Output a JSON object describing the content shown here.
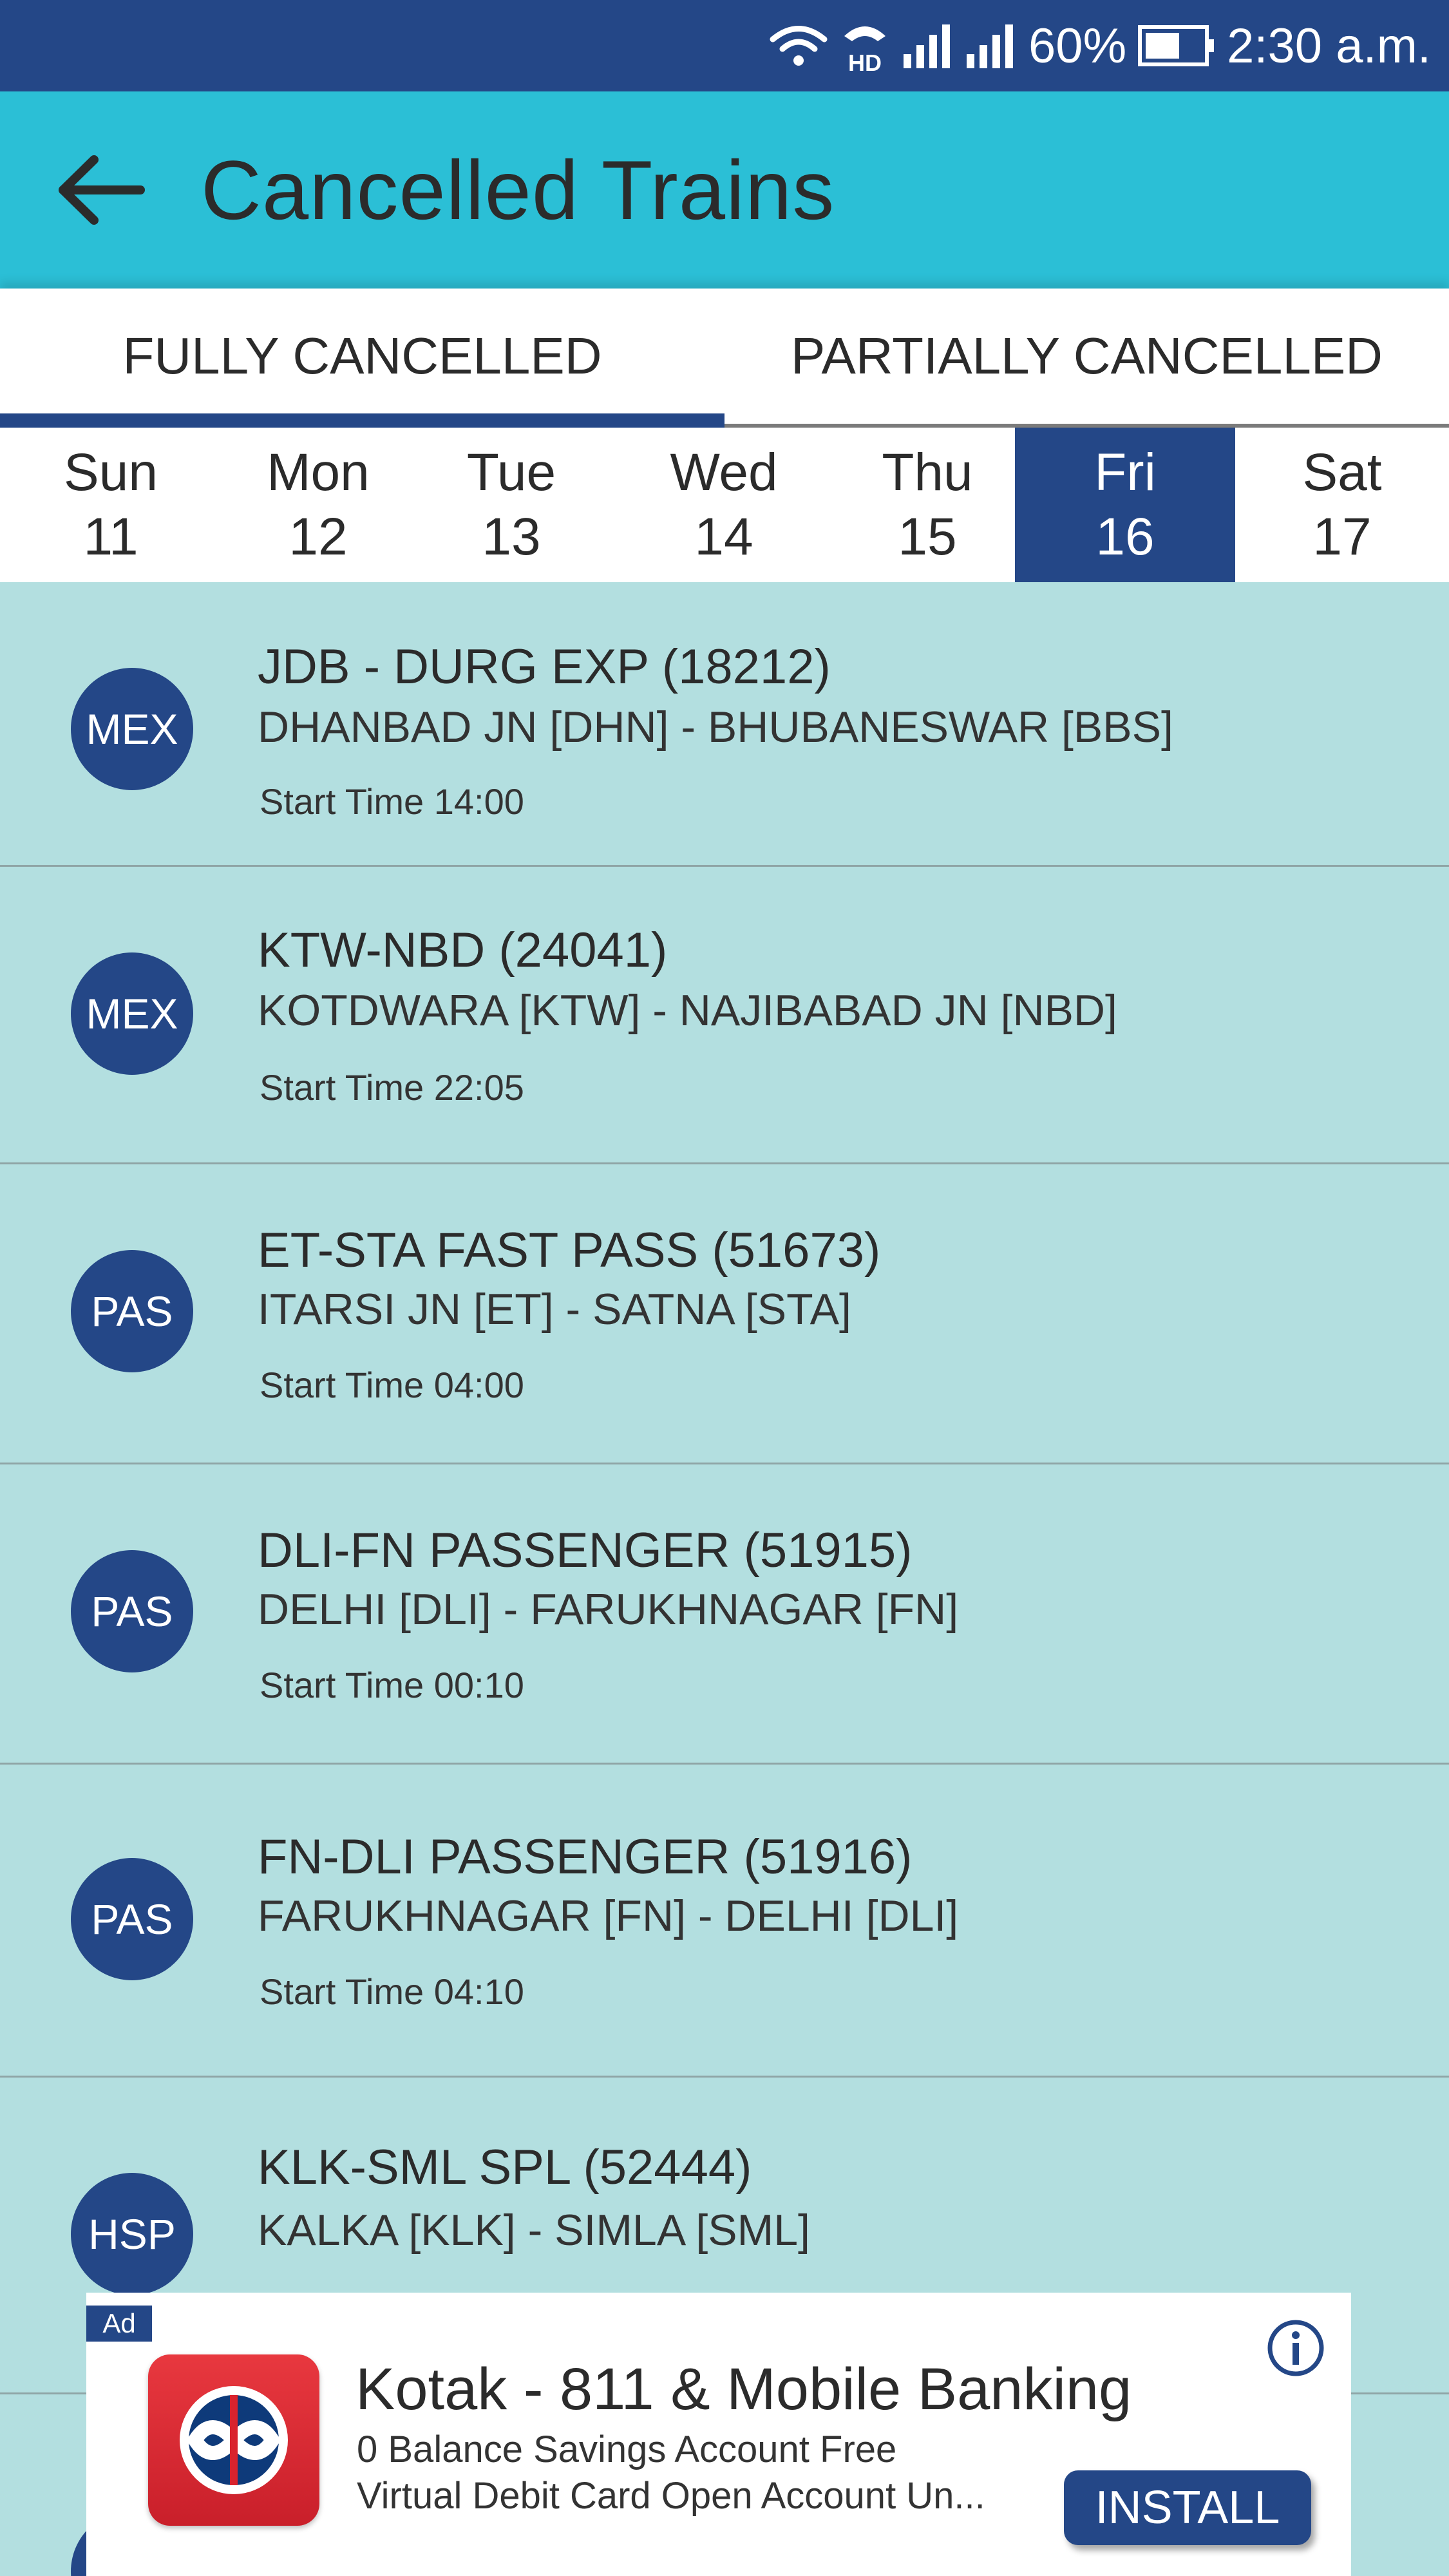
{
  "status_bar": {
    "battery": "60%",
    "time": "2:30 a.m.",
    "icons": [
      "wifi-icon",
      "hd-call-icon",
      "signal-icon",
      "signal-icon",
      "battery-icon"
    ]
  },
  "app_bar": {
    "title": "Cancelled Trains",
    "back_icon": "arrow-left-icon"
  },
  "tabs": [
    {
      "label": "FULLY CANCELLED",
      "active": true
    },
    {
      "label": "PARTIALLY CANCELLED",
      "active": false
    }
  ],
  "days": [
    {
      "day": "Sun",
      "date": "11",
      "selected": false
    },
    {
      "day": "Mon",
      "date": "12",
      "selected": false
    },
    {
      "day": "Tue",
      "date": "13",
      "selected": false
    },
    {
      "day": "Wed",
      "date": "14",
      "selected": false
    },
    {
      "day": "Thu",
      "date": "15",
      "selected": false
    },
    {
      "day": "Fri",
      "date": "16",
      "selected": true
    },
    {
      "day": "Sat",
      "date": "17",
      "selected": false
    }
  ],
  "trains": [
    {
      "type": "MEX",
      "name": "JDB - DURG EXP (18212)",
      "route": "DHANBAD JN [DHN] - BHUBANESWAR [BBS]",
      "start": "Start Time 14:00"
    },
    {
      "type": "MEX",
      "name": "KTW-NBD (24041)",
      "route": "KOTDWARA [KTW] - NAJIBABAD JN [NBD]",
      "start": "Start Time 22:05"
    },
    {
      "type": "PAS",
      "name": "ET-STA FAST PASS (51673)",
      "route": "ITARSI JN [ET] - SATNA [STA]",
      "start": "Start Time 04:00"
    },
    {
      "type": "PAS",
      "name": "DLI-FN PASSENGER (51915)",
      "route": "DELHI [DLI] - FARUKHNAGAR [FN]",
      "start": "Start Time 00:10"
    },
    {
      "type": "PAS",
      "name": "FN-DLI PASSENGER (51916)",
      "route": "FARUKHNAGAR [FN] - DELHI [DLI]",
      "start": "Start Time 04:10"
    },
    {
      "type": "HSP",
      "name": "KLK-SML SPL (52444)",
      "route": "KALKA [KLK] - SIMLA [SML]",
      "start": ""
    }
  ],
  "ad": {
    "tag": "Ad",
    "title": "Kotak - 811 & Mobile Banking",
    "desc_line1": "0 Balance Savings Account Free",
    "desc_line2": "Virtual Debit Card  Open Account Un...",
    "button": "INSTALL",
    "info_icon": "info-icon",
    "logo_icon": "kotak-logo-icon"
  },
  "colors": {
    "status_bar": "#244787",
    "app_bar": "#2bbfd6",
    "accent": "#244787",
    "list_bg": "#b3dfe0"
  }
}
